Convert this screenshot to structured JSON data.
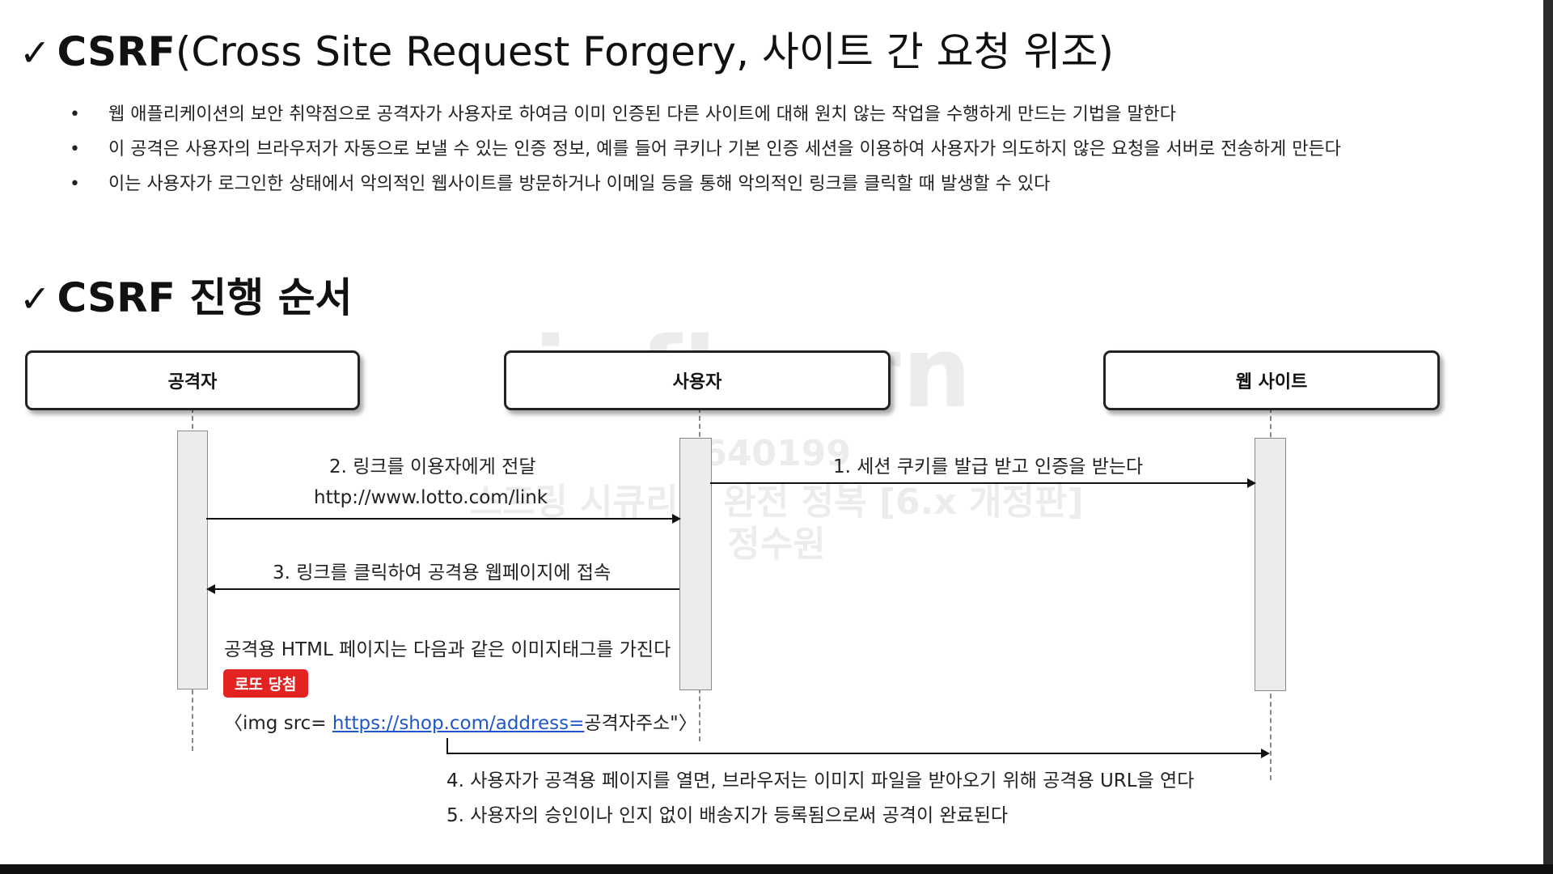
{
  "heading1": {
    "check": "✓",
    "bold": "CSRF",
    "rest": "(Cross Site Request Forgery, 사이트 간 요청 위조)"
  },
  "bullets": [
    "웹 애플리케이션의 보안 취약점으로 공격자가 사용자로 하여금 이미 인증된 다른 사이트에 대해 원치 않는 작업을 수행하게 만드는 기법을 말한다",
    "이 공격은 사용자의 브라우저가 자동으로 보낼 수 있는 인증 정보, 예를 들어 쿠키나 기본 인증 세션을 이용하여 사용자가 의도하지 않은 요청을 서버로 전송하게 만든다",
    "이는 사용자가 로그인한 상태에서 악의적인 웹사이트를 방문하거나 이메일 등을 통해 악의적인 링크를 클릭할 때 발생할 수 있다"
  ],
  "heading2": {
    "check": "✓",
    "bold": "CSRF 진행 순서"
  },
  "actors": {
    "attacker": "공격자",
    "user": "사용자",
    "website": "웹 사이트"
  },
  "steps": {
    "step1": "1. 세션 쿠키를 발급 받고 인증을 받는다",
    "step2": "2. 링크를 이용자에게 전달",
    "step2_url": "http://www.lotto.com/link",
    "step3": "3.  링크를 클릭하여  공격용  웹페이지에 접속",
    "html_note": "공격용 HTML 페이지는 다음과 같은 이미지태그를 가진다",
    "badge": "로또 당첨",
    "img_prefix": "〈img src= ",
    "img_link": "https://shop.com/address=",
    "img_suffix": "공격자주소\"〉",
    "step4": "4. 사용자가 공격용 페이지를 열면, 브라우저는 이미지 파일을 받아오기 위해 공격용 URL을 연다",
    "step5": "5. 사용자의 승인이나 인지 없이 배송지가 등록됨으로써 공격이 완료된다"
  },
  "watermark": {
    "logo": "inflearn",
    "id": "640199",
    "course": "스프링 시큐리티 완전 정복 [6.x 개정판]",
    "name": "정수원"
  },
  "colors": {
    "badge": "#e32222",
    "link": "#1f56c9",
    "activation": "#ececec"
  }
}
